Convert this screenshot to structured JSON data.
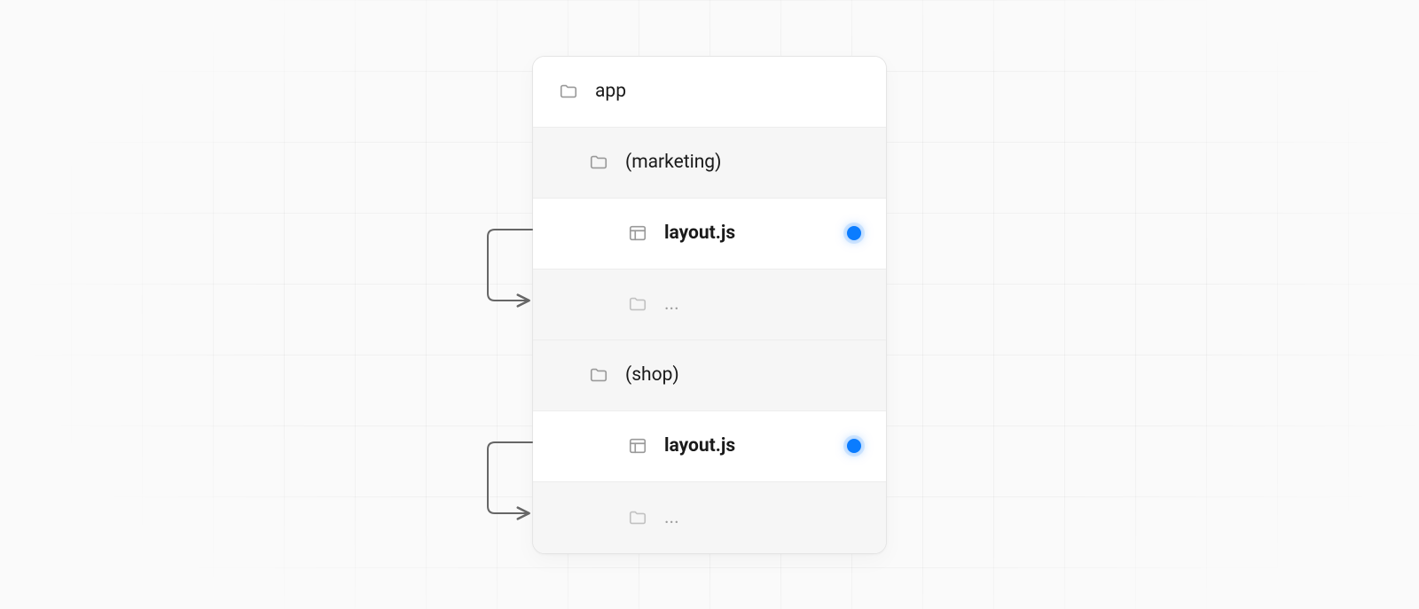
{
  "tree": {
    "root": {
      "label": "app",
      "icon": "folder"
    },
    "groups": [
      {
        "folder": {
          "label": "(marketing)",
          "icon": "folder"
        },
        "layout": {
          "label": "layout.js",
          "icon": "layout",
          "active": true
        },
        "children": {
          "label": "...",
          "icon": "folder"
        }
      },
      {
        "folder": {
          "label": "(shop)",
          "icon": "folder"
        },
        "layout": {
          "label": "layout.js",
          "icon": "layout",
          "active": true
        },
        "children": {
          "label": "...",
          "icon": "folder"
        }
      }
    ]
  },
  "colors": {
    "active_dot": "#0a7cff",
    "border": "#e5e5e5",
    "shaded_row": "#f6f6f6",
    "icon_muted": "#c2c2c2",
    "icon": "#9a9a9a"
  }
}
